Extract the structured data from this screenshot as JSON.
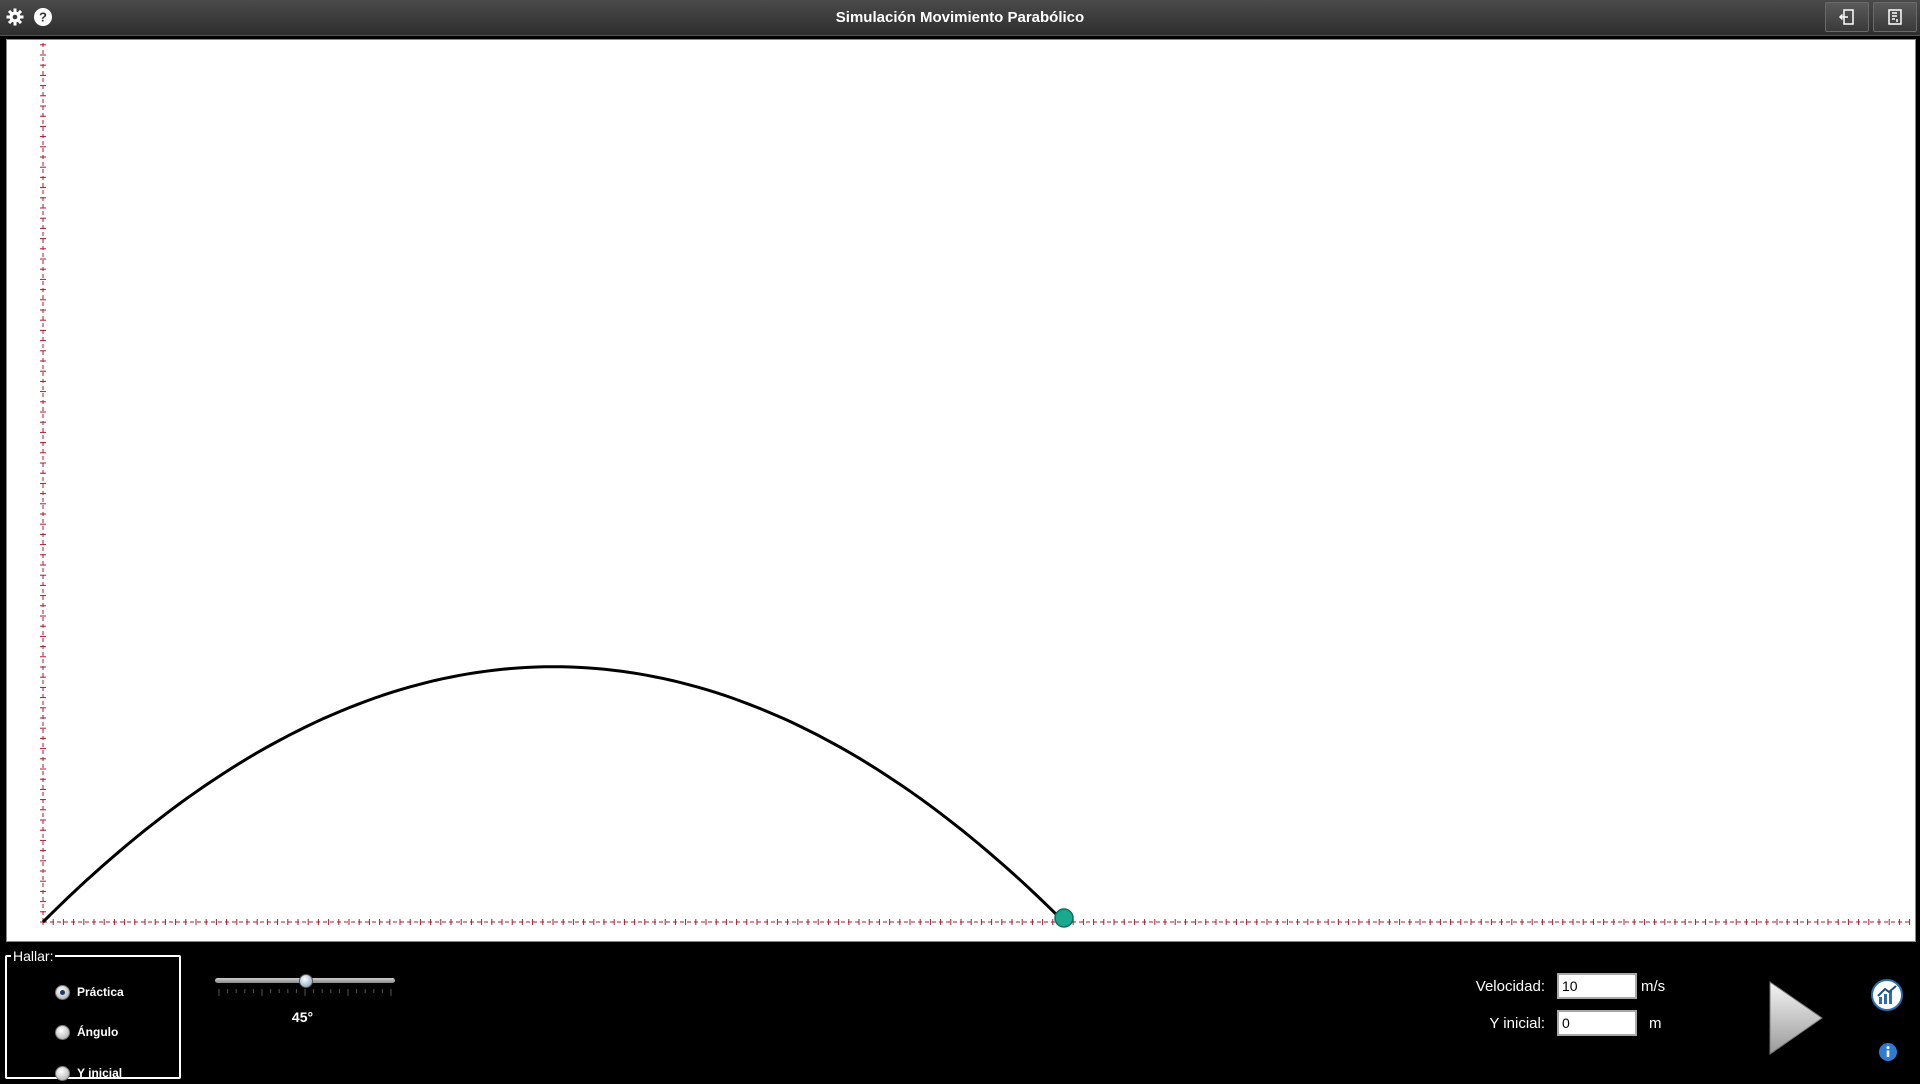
{
  "app": {
    "title": "Simulación Movimiento Parabólico"
  },
  "icons": {
    "settings": "gear-icon",
    "help": "help-icon",
    "exit": "exit-icon",
    "fullscreen": "fullscreen-icon",
    "play": "play-icon",
    "graph": "graph-icon",
    "info": "info-icon"
  },
  "simulation": {
    "launch_angle_deg": 45,
    "initial_speed_mps": 10,
    "initial_y_m": 0,
    "trajectory_color": "#000000",
    "axis_tick_color": "#b0182b",
    "ball_color": "#1aa88f"
  },
  "controls": {
    "hallar": {
      "legend": "Hallar:",
      "options": [
        {
          "label": "Práctica",
          "checked": true
        },
        {
          "label": "Ángulo",
          "checked": false
        },
        {
          "label": "Y inicial",
          "checked": false
        }
      ]
    },
    "angle_slider": {
      "value_label": "45°",
      "value_fraction": 0.5
    },
    "velocity": {
      "label": "Velocidad:",
      "value": "10",
      "unit": "m/s"
    },
    "y_initial": {
      "label": "Y inicial:",
      "value": "0",
      "unit": "m"
    }
  }
}
